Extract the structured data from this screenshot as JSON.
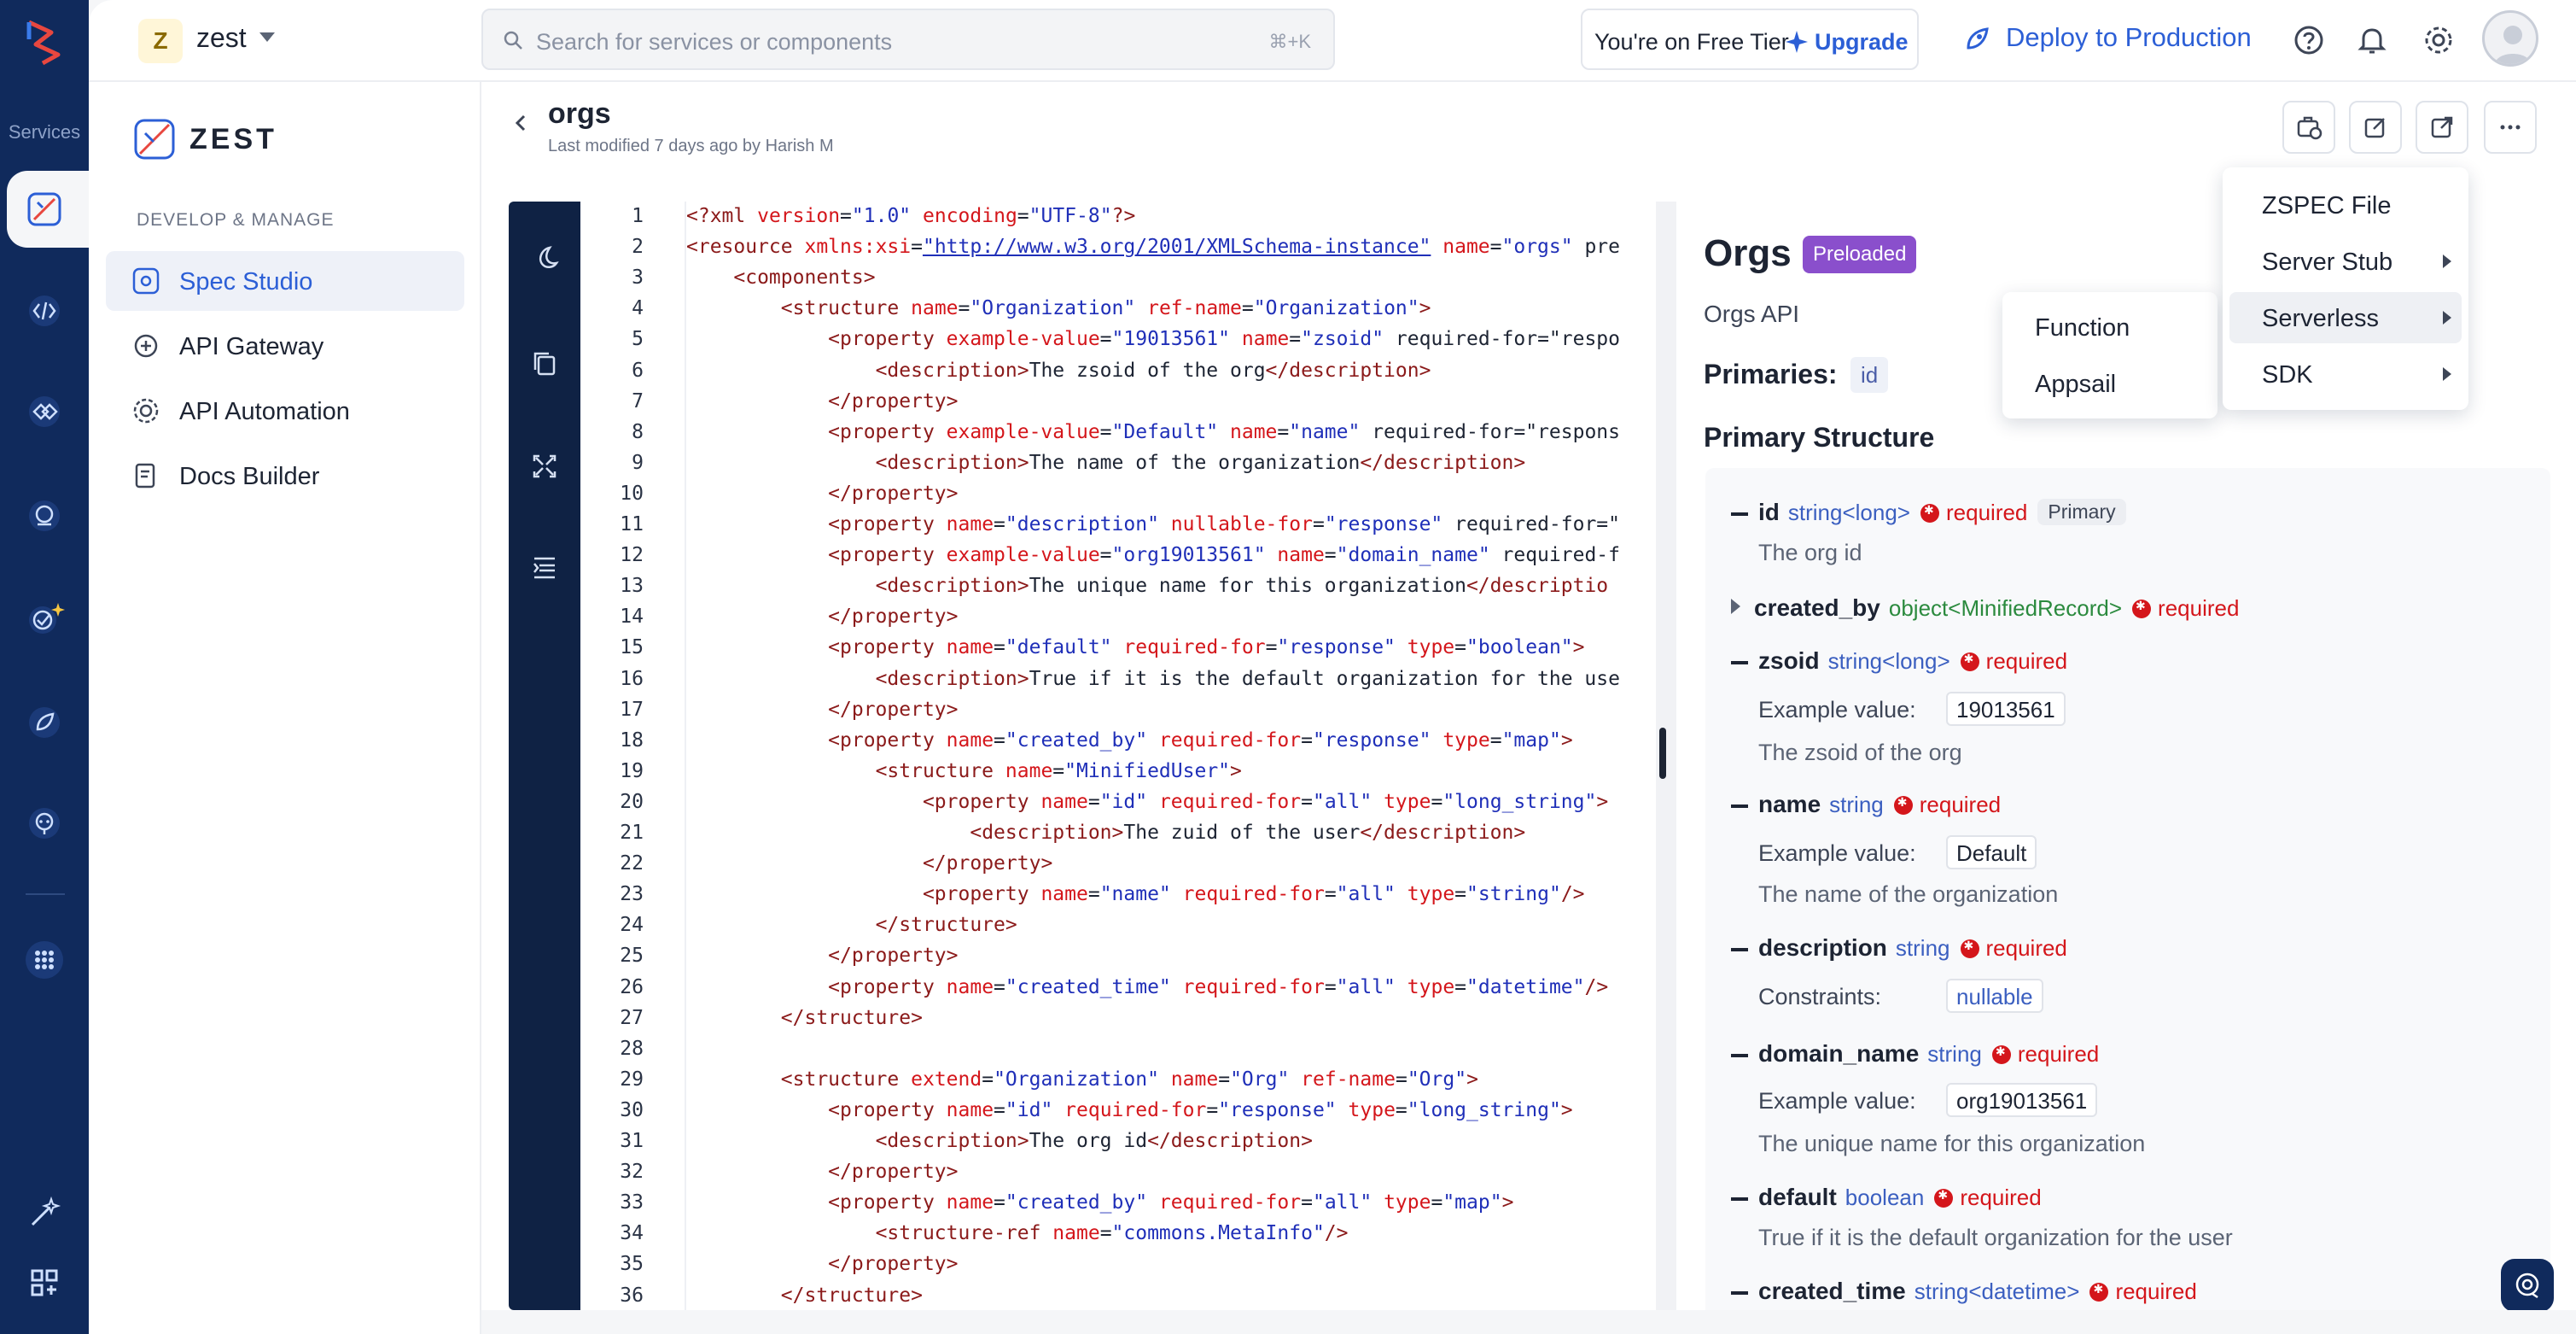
{
  "rail": {
    "label": "Services",
    "items": [
      {
        "name": "spec-studio-rail-icon"
      },
      {
        "name": "api-gateway-rail-icon"
      },
      {
        "name": "api-automation-rail-icon"
      },
      {
        "name": "insights-rail-icon"
      },
      {
        "name": "ai-testing-rail-icon"
      },
      {
        "name": "deploy-rail-icon"
      },
      {
        "name": "support-rail-icon"
      },
      {
        "name": "apps-grid-rail-icon"
      }
    ]
  },
  "workspace": {
    "initial": "Z",
    "name": "zest"
  },
  "search": {
    "placeholder": "Search for services or components",
    "shortcut": "⌘+K"
  },
  "tier": {
    "text": "You're on Free Tier",
    "upgrade": "Upgrade"
  },
  "deploy": {
    "label": "Deploy to Production"
  },
  "sidebar": {
    "brand": "ZEST",
    "section": "DEVELOP & MANAGE",
    "items": [
      {
        "label": "Spec Studio",
        "active": true
      },
      {
        "label": "API Gateway",
        "active": false
      },
      {
        "label": "API Automation",
        "active": false
      },
      {
        "label": "Docs Builder",
        "active": false
      }
    ]
  },
  "file": {
    "title": "orgs",
    "meta": "Last modified 7 days ago by Harish M"
  },
  "code": {
    "line_numbers": [
      "1",
      "2",
      "3",
      "4",
      "5",
      "6",
      "7",
      "8",
      "9",
      "10",
      "11",
      "12",
      "13",
      "14",
      "15",
      "16",
      "17",
      "18",
      "19",
      "20",
      "21",
      "22",
      "23",
      "24",
      "25",
      "26",
      "27",
      "28",
      "29",
      "30",
      "31",
      "32",
      "33",
      "34",
      "35",
      "36"
    ],
    "lines": [
      "<?xml version=\"1.0\" encoding=\"UTF-8\"?>",
      "<resource xmlns:xsi=\"http://www.w3.org/2001/XMLSchema-instance\" name=\"orgs\" pre",
      "    <components>",
      "        <structure name=\"Organization\" ref-name=\"Organization\">",
      "            <property example-value=\"19013561\" name=\"zsoid\" required-for=\"respo",
      "                <description>The zsoid of the org</description>",
      "            </property>",
      "            <property example-value=\"Default\" name=\"name\" required-for=\"respons",
      "                <description>The name of the organization</description>",
      "            </property>",
      "            <property name=\"description\" nullable-for=\"response\" required-for=\"",
      "            <property example-value=\"org19013561\" name=\"domain_name\" required-f",
      "                <description>The unique name for this organization</descriptio",
      "            </property>",
      "            <property name=\"default\" required-for=\"response\" type=\"boolean\">",
      "                <description>True if it is the default organization for the use",
      "            </property>",
      "            <property name=\"created_by\" required-for=\"response\" type=\"map\">",
      "                <structure name=\"MinifiedUser\">",
      "                    <property name=\"id\" required-for=\"all\" type=\"long_string\">",
      "                        <description>The zuid of the user</description>",
      "                    </property>",
      "                    <property name=\"name\" required-for=\"all\" type=\"string\"/>",
      "                </structure>",
      "            </property>",
      "            <property name=\"created_time\" required-for=\"all\" type=\"datetime\"/>",
      "        </structure>",
      "",
      "        <structure extend=\"Organization\" name=\"Org\" ref-name=\"Org\">",
      "            <property name=\"id\" required-for=\"response\" type=\"long_string\">",
      "                <description>The org id</description>",
      "            </property>",
      "            <property name=\"created_by\" required-for=\"all\" type=\"map\">",
      "                <structure-ref name=\"commons.MetaInfo\"/>",
      "            </property>",
      "        </structure>"
    ]
  },
  "preview": {
    "title": "Orgs",
    "badge": "Preloaded",
    "subtitle": "Orgs API",
    "primaries_label": "Primaries:",
    "primaries_value": "id",
    "structure_heading": "Primary Structure",
    "required_text": "required",
    "example_label": "Example value:",
    "constraints_label": "Constraints:",
    "props": [
      {
        "name": "id",
        "type": "string<long>",
        "pill": "Primary",
        "desc": "The org id"
      },
      {
        "name": "created_by",
        "type": "object<MinifiedRecord>"
      },
      {
        "name": "zsoid",
        "type": "string<long>",
        "example": "19013561",
        "desc": "The zsoid of the org"
      },
      {
        "name": "name",
        "type": "string",
        "example": "Default",
        "desc": "The name of the organization"
      },
      {
        "name": "description",
        "type": "string",
        "constraint": "nullable"
      },
      {
        "name": "domain_name",
        "type": "string",
        "example": "org19013561",
        "desc": "The unique name for this organization"
      },
      {
        "name": "default",
        "type": "boolean",
        "desc": "True if it is the default organization for the user"
      },
      {
        "name": "created_time",
        "type": "string<datetime>"
      }
    ]
  },
  "export_menu": {
    "items": [
      {
        "label": "ZSPEC File",
        "has_sub": false
      },
      {
        "label": "Server Stub",
        "has_sub": true
      },
      {
        "label": "Serverless",
        "has_sub": true
      },
      {
        "label": "SDK",
        "has_sub": true
      }
    ],
    "submenu": [
      "Function",
      "Appsail"
    ]
  },
  "colors": {
    "rail": "#102a5c",
    "accent": "#2c5fd6",
    "badge": "#8a4fcc",
    "required": "#d4161b"
  }
}
